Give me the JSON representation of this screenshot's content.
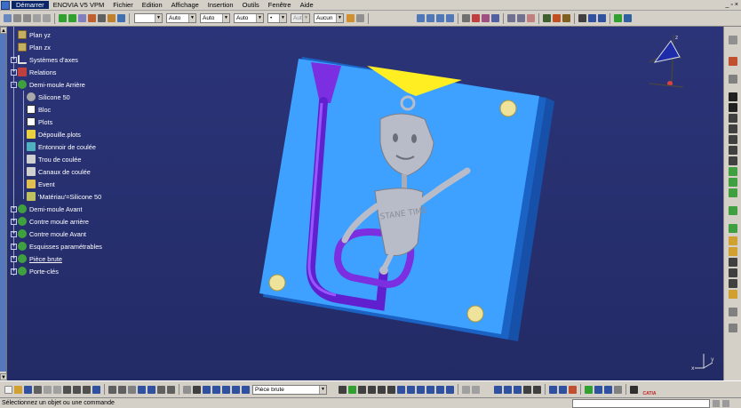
{
  "menu": {
    "items": [
      "Démarrer",
      "ENOVIA V5 VPM",
      "Fichier",
      "Edition",
      "Affichage",
      "Insertion",
      "Outils",
      "Fenêtre",
      "Aide"
    ],
    "active_index": 0,
    "window_controls": [
      "_",
      "▫",
      "×"
    ]
  },
  "toolbar_top": {
    "color_combo": "",
    "linetype_combo": "Auto",
    "thickness_combo": "Auto",
    "linestyle_combo": "Auto",
    "point_combo": "•",
    "layer_combo_disabled": "Aut",
    "render_combo": "Aucun"
  },
  "tree": {
    "nodes": [
      {
        "label": "Plan yz",
        "icon": "plane-icon",
        "indent": 1
      },
      {
        "label": "Plan zx",
        "icon": "plane-icon",
        "indent": 1
      },
      {
        "label": "Systèmes d'axes",
        "icon": "axis-system-icon",
        "indent": 1,
        "expander": "+"
      },
      {
        "label": "Relations",
        "icon": "relations-icon",
        "indent": 1,
        "expander": "+"
      },
      {
        "label": "Demi-moule Arrière",
        "icon": "body-gear-icon",
        "indent": 1,
        "expander": "-"
      },
      {
        "label": "Silicone 50",
        "icon": "material-sphere-icon",
        "indent": 2
      },
      {
        "label": "Bloc",
        "icon": "pad-icon",
        "indent": 2
      },
      {
        "label": "Plots",
        "icon": "pad-icon",
        "indent": 2
      },
      {
        "label": "Dépouille.plots",
        "icon": "draft-icon",
        "indent": 2
      },
      {
        "label": "Entonnoir de coulée",
        "icon": "shaft-icon",
        "indent": 2
      },
      {
        "label": "Trou de coulée",
        "icon": "rib-icon",
        "indent": 2
      },
      {
        "label": "Canaux de coulée",
        "icon": "rib-icon",
        "indent": 2
      },
      {
        "label": "Event",
        "icon": "pocket-icon",
        "indent": 2
      },
      {
        "label": "'Matériau'=Silicone 50",
        "icon": "formula-icon",
        "indent": 2
      },
      {
        "label": "Demi-moule Avant",
        "icon": "body-gear-icon",
        "indent": 1,
        "expander": "+"
      },
      {
        "label": "Contre moule arrière",
        "icon": "body-gear-icon",
        "indent": 1,
        "expander": "+"
      },
      {
        "label": "Contre moule Avant",
        "icon": "body-gear-icon",
        "indent": 1,
        "expander": "+"
      },
      {
        "label": "Esquisses paramétrables",
        "icon": "body-gear-icon",
        "indent": 1,
        "expander": "+"
      },
      {
        "label": "Pièce brute",
        "icon": "body-gear-icon",
        "indent": 1,
        "expander": "+",
        "underlined": true
      },
      {
        "label": "Porte-clés",
        "icon": "body-gear-icon",
        "indent": 1,
        "expander": "+"
      }
    ]
  },
  "model": {
    "mold_color": "#3ea0ff",
    "mold_side_color": "#1a62c4",
    "channel_color": "#7b2fe0",
    "funnel_color": "#ffee22",
    "figurine_color": "#b8bcc8",
    "pin_color": "#efe29a",
    "figurine_text": "STANE TIME"
  },
  "toolbar_bottom": {
    "active_part_combo": "Pièce brute"
  },
  "status": {
    "message": "Sélectionnez un objet ou une commande"
  },
  "compass_labels": {
    "x": "x",
    "y": "y",
    "z": "z"
  },
  "logo_text": "CATIA"
}
